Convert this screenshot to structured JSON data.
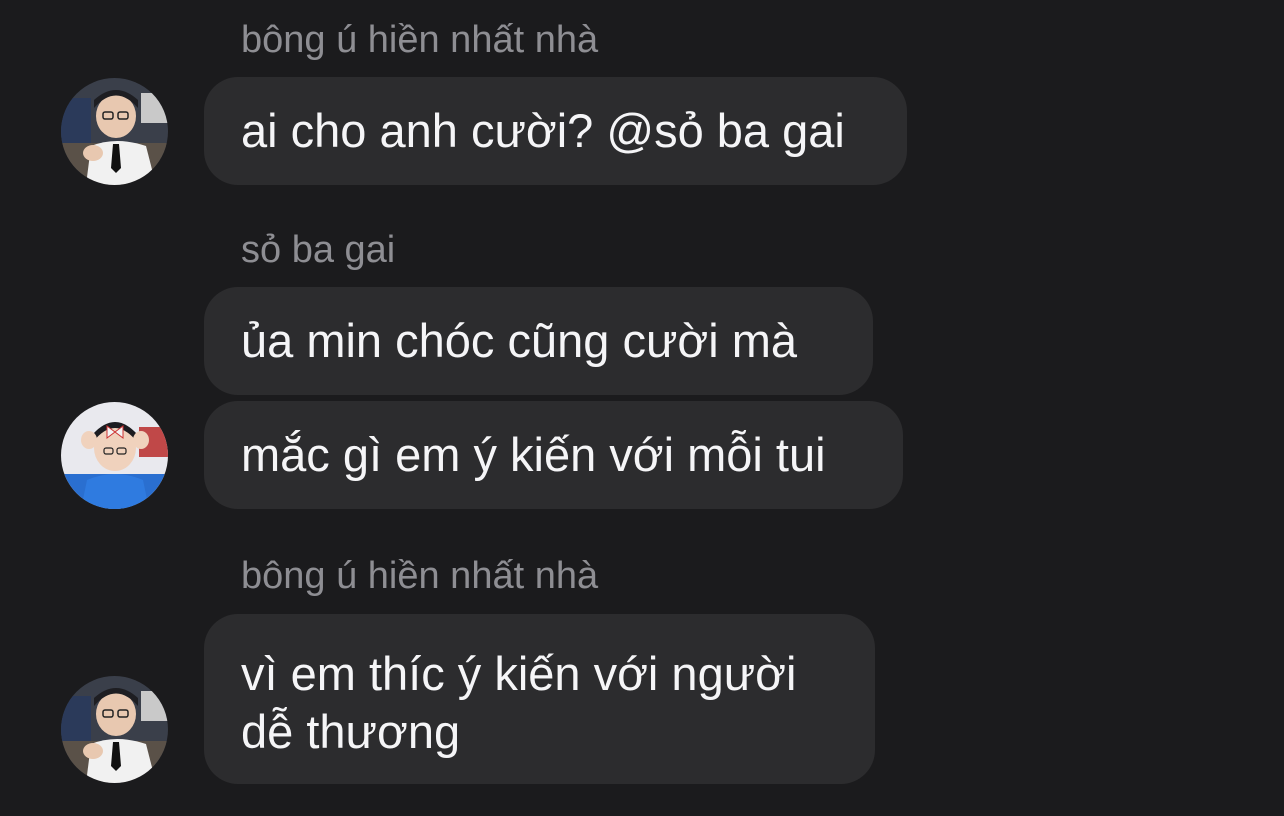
{
  "messages": [
    {
      "sender": "bông ú hiền nhất nhà",
      "bubbles": [
        "ai cho anh cười? @sỏ ba gai"
      ],
      "avatar": "user-photo-avatar-1"
    },
    {
      "sender": "sỏ ba gai",
      "bubbles": [
        "ủa min chóc cũng cười mà",
        "mắc gì em ý kiến với mỗi tui"
      ],
      "avatar": "user-photo-avatar-2"
    },
    {
      "sender": "bông ú hiền nhất nhà",
      "bubbles": [
        "vì em thíc ý kiến với người dễ thương"
      ],
      "avatar": "user-photo-avatar-1"
    }
  ],
  "colors": {
    "background": "#1b1b1d",
    "bubble": "#2c2c2e",
    "bubble_text": "#f5f5f7",
    "sender_text": "#8e8e93"
  }
}
